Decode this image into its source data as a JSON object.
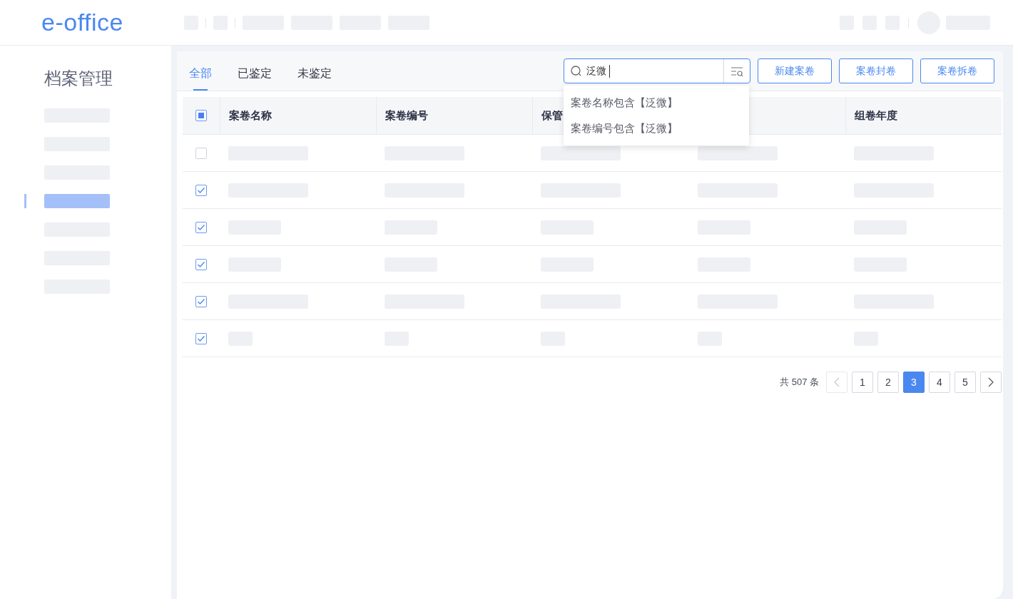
{
  "header": {
    "logo": "e-office"
  },
  "sidebar": {
    "title": "档案管理",
    "items": [
      {
        "selected": false
      },
      {
        "selected": false
      },
      {
        "selected": false
      },
      {
        "selected": true
      },
      {
        "selected": false
      },
      {
        "selected": false
      },
      {
        "selected": false
      }
    ]
  },
  "tabs": [
    {
      "label": "全部",
      "selected": true
    },
    {
      "label": "已鉴定",
      "selected": false
    },
    {
      "label": "未鉴定",
      "selected": false
    }
  ],
  "search": {
    "value": "泛微",
    "suggestions": [
      "案卷名称包含【泛微】",
      "案卷编号包含【泛微】"
    ]
  },
  "buttons": [
    "新建案卷",
    "案卷封卷",
    "案卷拆卷"
  ],
  "table": {
    "select_all": {
      "indeterminate": true
    },
    "columns": [
      {
        "label": "案卷名称"
      },
      {
        "label": "案卷编号"
      },
      {
        "label": "保管"
      },
      null,
      {
        "label": "组卷年度"
      }
    ],
    "rows": [
      {
        "checked": false
      },
      {
        "checked": true
      },
      {
        "checked": true
      },
      {
        "checked": true
      },
      {
        "checked": true
      },
      {
        "checked": true
      }
    ]
  },
  "pagination": {
    "total": "共 507 条",
    "prev_disabled": true,
    "next_disabled": false,
    "pages": [
      {
        "label": "1",
        "selected": false
      },
      {
        "label": "2",
        "selected": false
      },
      {
        "label": "3",
        "selected": true
      },
      {
        "label": "4",
        "selected": false
      },
      {
        "label": "5",
        "selected": false
      }
    ]
  }
}
